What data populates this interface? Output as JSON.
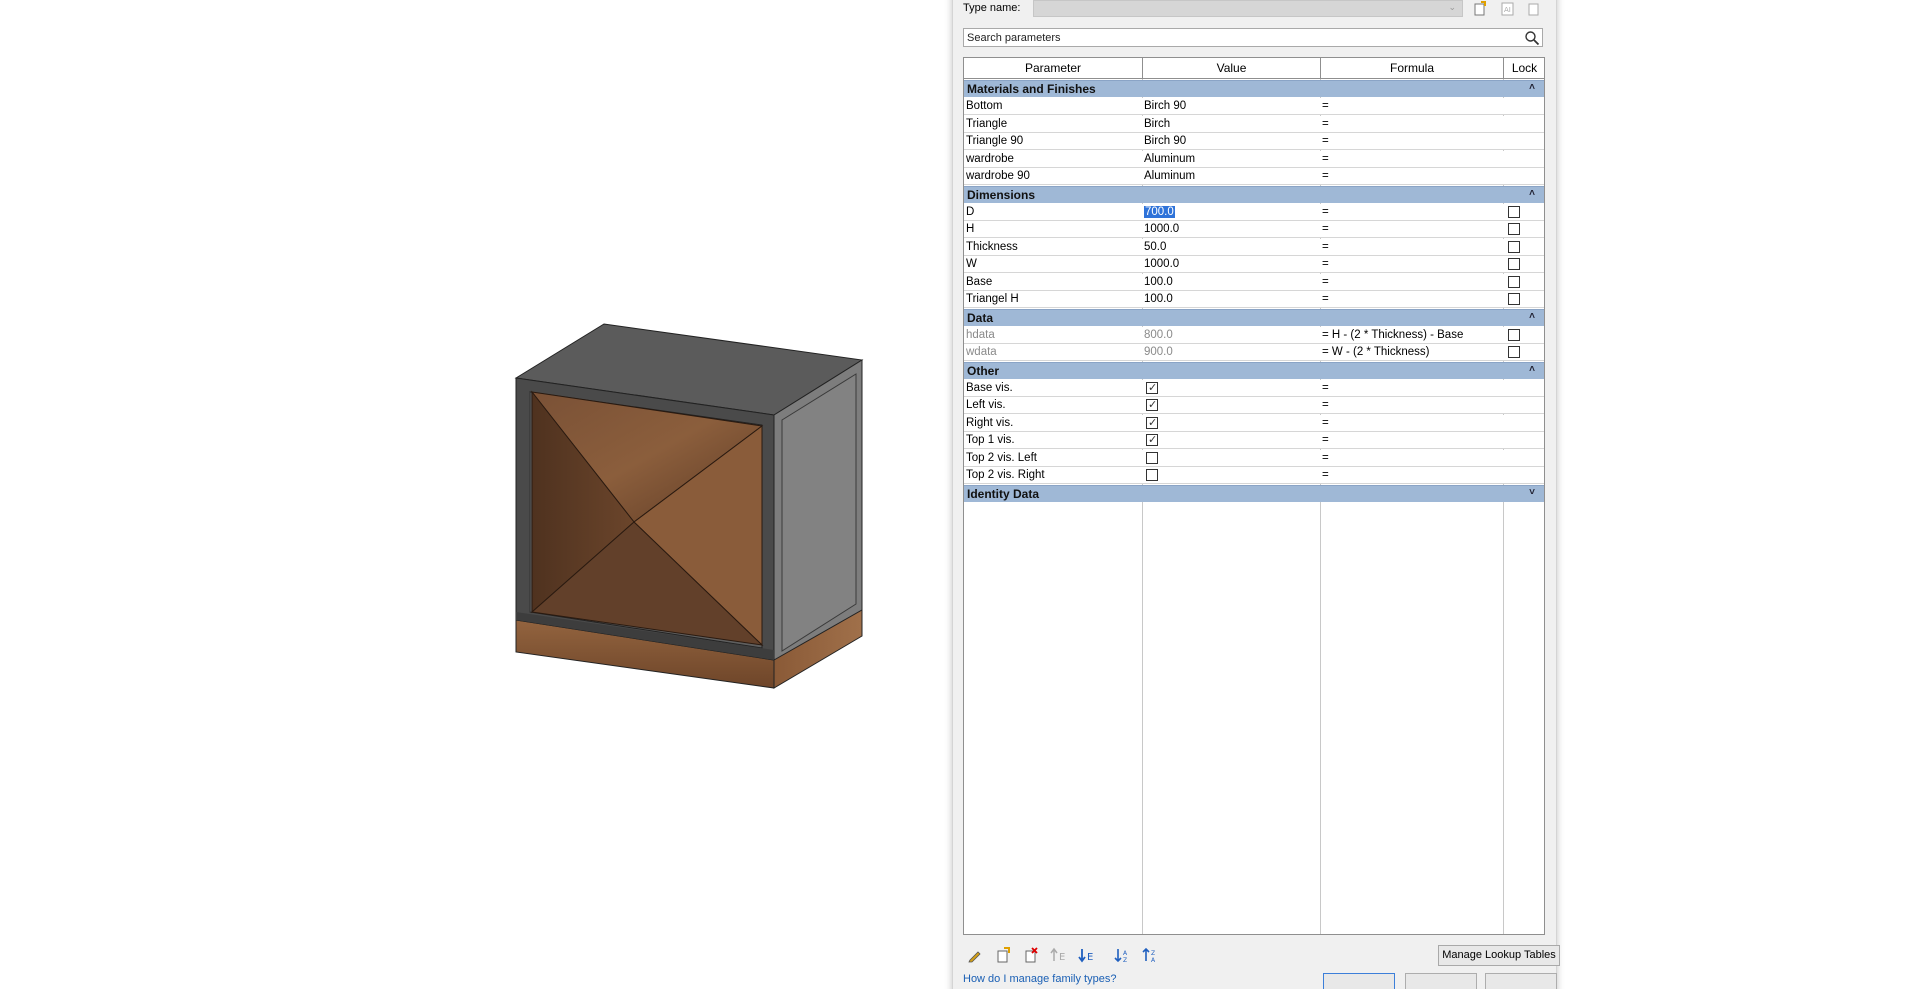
{
  "dialog": {
    "type_name_label": "Type name:",
    "type_name_value": "",
    "search_placeholder": "Search parameters",
    "columns": [
      "Parameter",
      "Value",
      "Formula",
      "Lock"
    ],
    "manage_lookup_label": "Manage Lookup Tables",
    "help_link": "How do I manage family types?"
  },
  "groups": [
    {
      "title": "Materials and Finishes",
      "chevron": "˄",
      "rows": [
        {
          "param": "Bottom",
          "value": "Birch 90",
          "formula": "="
        },
        {
          "param": "Triangle",
          "value": "Birch",
          "formula": "="
        },
        {
          "param": "Triangle 90",
          "value": "Birch 90",
          "formula": "="
        },
        {
          "param": "wardrobe",
          "value": "Aluminum",
          "formula": "="
        },
        {
          "param": "wardrobe 90",
          "value": "Aluminum",
          "formula": "="
        }
      ]
    },
    {
      "title": "Dimensions",
      "chevron": "˄",
      "rows": [
        {
          "param": "D",
          "value": "700.0",
          "formula": "=",
          "lock": false,
          "selected": true
        },
        {
          "param": "H",
          "value": "1000.0",
          "formula": "=",
          "lock": false
        },
        {
          "param": "Thickness",
          "value": "50.0",
          "formula": "=",
          "lock": false
        },
        {
          "param": "W",
          "value": "1000.0",
          "formula": "=",
          "lock": false
        },
        {
          "param": "Base",
          "value": "100.0",
          "formula": "=",
          "lock": false
        },
        {
          "param": "Triangel H",
          "value": "100.0",
          "formula": "=",
          "lock": false
        }
      ]
    },
    {
      "title": "Data",
      "chevron": "˄",
      "rows": [
        {
          "param": "hdata",
          "value": "800.0",
          "formula": "= H - (2 * Thickness) - Base",
          "lock": false,
          "dim": true
        },
        {
          "param": "wdata",
          "value": "900.0",
          "formula": "= W - (2 * Thickness)",
          "lock": false,
          "dim": true
        }
      ]
    },
    {
      "title": "Other",
      "chevron": "˄",
      "rows": [
        {
          "param": "Base vis.",
          "check": true,
          "formula": "="
        },
        {
          "param": "Left vis.",
          "check": true,
          "formula": "="
        },
        {
          "param": "Right vis.",
          "check": true,
          "formula": "="
        },
        {
          "param": "Top 1 vis.",
          "check": true,
          "formula": "="
        },
        {
          "param": "Top 2 vis. Left",
          "check": false,
          "formula": "="
        },
        {
          "param": "Top 2 vis. Right",
          "check": false,
          "formula": "="
        }
      ]
    },
    {
      "title": "Identity Data",
      "chevron": "˅",
      "rows": []
    }
  ],
  "toolbar_icons": [
    "edit-parameter-icon",
    "new-parameter-icon",
    "delete-parameter-icon",
    "move-up-icon",
    "move-down-icon",
    "sort-ascending-icon",
    "sort-descending-icon"
  ],
  "colors": {
    "group_header": "#9fb8d6",
    "selection": "#2f73d9",
    "link": "#1a5fb4"
  }
}
